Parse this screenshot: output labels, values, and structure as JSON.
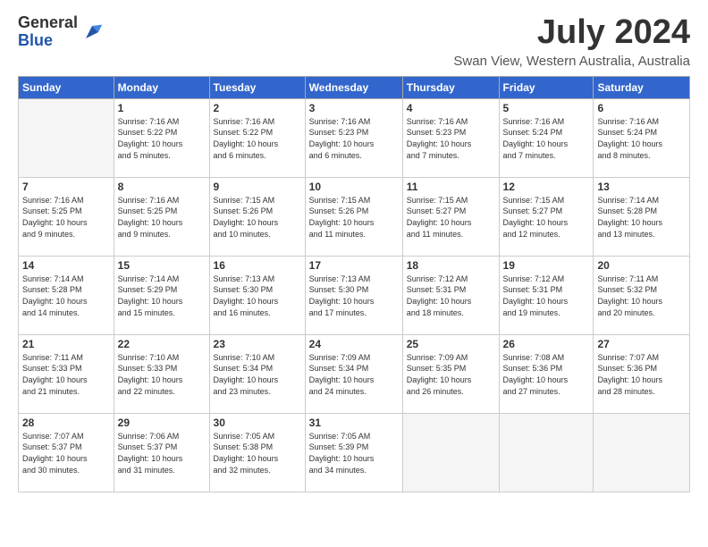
{
  "logo": {
    "general": "General",
    "blue": "Blue"
  },
  "title": {
    "month_year": "July 2024",
    "location": "Swan View, Western Australia, Australia"
  },
  "header_days": [
    "Sunday",
    "Monday",
    "Tuesday",
    "Wednesday",
    "Thursday",
    "Friday",
    "Saturday"
  ],
  "weeks": [
    [
      {
        "day": "",
        "info": ""
      },
      {
        "day": "1",
        "info": "Sunrise: 7:16 AM\nSunset: 5:22 PM\nDaylight: 10 hours\nand 5 minutes."
      },
      {
        "day": "2",
        "info": "Sunrise: 7:16 AM\nSunset: 5:22 PM\nDaylight: 10 hours\nand 6 minutes."
      },
      {
        "day": "3",
        "info": "Sunrise: 7:16 AM\nSunset: 5:23 PM\nDaylight: 10 hours\nand 6 minutes."
      },
      {
        "day": "4",
        "info": "Sunrise: 7:16 AM\nSunset: 5:23 PM\nDaylight: 10 hours\nand 7 minutes."
      },
      {
        "day": "5",
        "info": "Sunrise: 7:16 AM\nSunset: 5:24 PM\nDaylight: 10 hours\nand 7 minutes."
      },
      {
        "day": "6",
        "info": "Sunrise: 7:16 AM\nSunset: 5:24 PM\nDaylight: 10 hours\nand 8 minutes."
      }
    ],
    [
      {
        "day": "7",
        "info": "Sunrise: 7:16 AM\nSunset: 5:25 PM\nDaylight: 10 hours\nand 9 minutes."
      },
      {
        "day": "8",
        "info": "Sunrise: 7:16 AM\nSunset: 5:25 PM\nDaylight: 10 hours\nand 9 minutes."
      },
      {
        "day": "9",
        "info": "Sunrise: 7:15 AM\nSunset: 5:26 PM\nDaylight: 10 hours\nand 10 minutes."
      },
      {
        "day": "10",
        "info": "Sunrise: 7:15 AM\nSunset: 5:26 PM\nDaylight: 10 hours\nand 11 minutes."
      },
      {
        "day": "11",
        "info": "Sunrise: 7:15 AM\nSunset: 5:27 PM\nDaylight: 10 hours\nand 11 minutes."
      },
      {
        "day": "12",
        "info": "Sunrise: 7:15 AM\nSunset: 5:27 PM\nDaylight: 10 hours\nand 12 minutes."
      },
      {
        "day": "13",
        "info": "Sunrise: 7:14 AM\nSunset: 5:28 PM\nDaylight: 10 hours\nand 13 minutes."
      }
    ],
    [
      {
        "day": "14",
        "info": "Sunrise: 7:14 AM\nSunset: 5:28 PM\nDaylight: 10 hours\nand 14 minutes."
      },
      {
        "day": "15",
        "info": "Sunrise: 7:14 AM\nSunset: 5:29 PM\nDaylight: 10 hours\nand 15 minutes."
      },
      {
        "day": "16",
        "info": "Sunrise: 7:13 AM\nSunset: 5:30 PM\nDaylight: 10 hours\nand 16 minutes."
      },
      {
        "day": "17",
        "info": "Sunrise: 7:13 AM\nSunset: 5:30 PM\nDaylight: 10 hours\nand 17 minutes."
      },
      {
        "day": "18",
        "info": "Sunrise: 7:12 AM\nSunset: 5:31 PM\nDaylight: 10 hours\nand 18 minutes."
      },
      {
        "day": "19",
        "info": "Sunrise: 7:12 AM\nSunset: 5:31 PM\nDaylight: 10 hours\nand 19 minutes."
      },
      {
        "day": "20",
        "info": "Sunrise: 7:11 AM\nSunset: 5:32 PM\nDaylight: 10 hours\nand 20 minutes."
      }
    ],
    [
      {
        "day": "21",
        "info": "Sunrise: 7:11 AM\nSunset: 5:33 PM\nDaylight: 10 hours\nand 21 minutes."
      },
      {
        "day": "22",
        "info": "Sunrise: 7:10 AM\nSunset: 5:33 PM\nDaylight: 10 hours\nand 22 minutes."
      },
      {
        "day": "23",
        "info": "Sunrise: 7:10 AM\nSunset: 5:34 PM\nDaylight: 10 hours\nand 23 minutes."
      },
      {
        "day": "24",
        "info": "Sunrise: 7:09 AM\nSunset: 5:34 PM\nDaylight: 10 hours\nand 24 minutes."
      },
      {
        "day": "25",
        "info": "Sunrise: 7:09 AM\nSunset: 5:35 PM\nDaylight: 10 hours\nand 26 minutes."
      },
      {
        "day": "26",
        "info": "Sunrise: 7:08 AM\nSunset: 5:36 PM\nDaylight: 10 hours\nand 27 minutes."
      },
      {
        "day": "27",
        "info": "Sunrise: 7:07 AM\nSunset: 5:36 PM\nDaylight: 10 hours\nand 28 minutes."
      }
    ],
    [
      {
        "day": "28",
        "info": "Sunrise: 7:07 AM\nSunset: 5:37 PM\nDaylight: 10 hours\nand 30 minutes."
      },
      {
        "day": "29",
        "info": "Sunrise: 7:06 AM\nSunset: 5:37 PM\nDaylight: 10 hours\nand 31 minutes."
      },
      {
        "day": "30",
        "info": "Sunrise: 7:05 AM\nSunset: 5:38 PM\nDaylight: 10 hours\nand 32 minutes."
      },
      {
        "day": "31",
        "info": "Sunrise: 7:05 AM\nSunset: 5:39 PM\nDaylight: 10 hours\nand 34 minutes."
      },
      {
        "day": "",
        "info": ""
      },
      {
        "day": "",
        "info": ""
      },
      {
        "day": "",
        "info": ""
      }
    ]
  ]
}
